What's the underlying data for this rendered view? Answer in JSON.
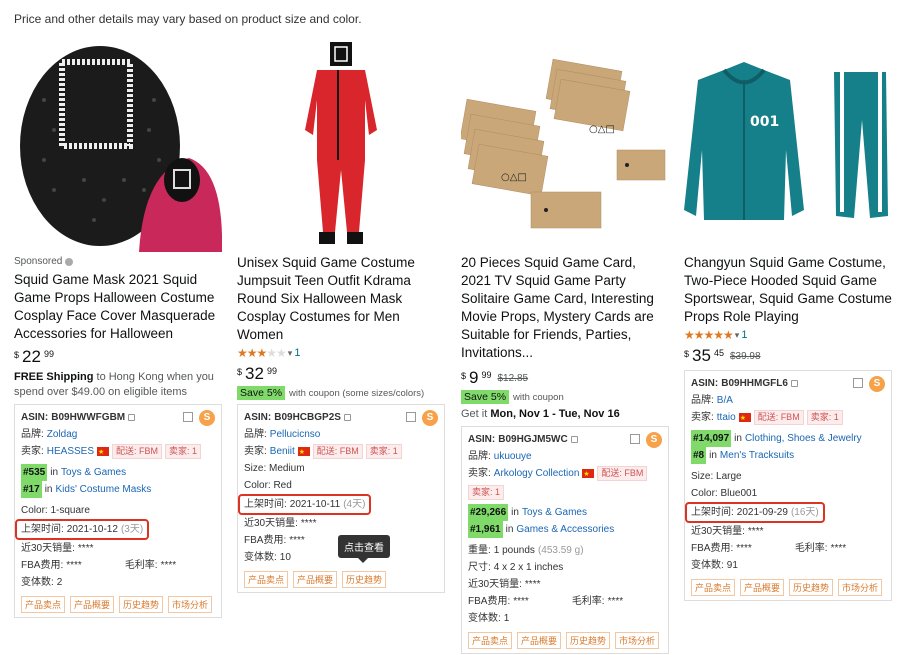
{
  "notice": "Price and other details may vary based on product size and color.",
  "tooltip": "点击查看",
  "products": [
    {
      "sponsored": "Sponsored",
      "title": "Squid Game Mask 2021 Squid Game Props Halloween Costume Cosplay Face Cover Masquerade Accessories for Halloween",
      "price_whole": "22",
      "price_frac": "99",
      "currency": "$",
      "shipping_bold": "FREE Shipping",
      "shipping_rest": " to Hong Kong when you spend over $49.00 on eligible items",
      "asin_label": "ASIN: ",
      "asin": "B09HWWFGBM",
      "brand_label": "品牌:",
      "brand": "Zoldag",
      "seller_label": "卖家:",
      "seller": "HEASSES",
      "tag1": "配送: FBM",
      "tag2": "卖家: 1",
      "rank1": "#535",
      "rank1_in": " in ",
      "rank1_cat": "Toys & Games",
      "rank2": "#17",
      "rank2_in": " in ",
      "rank2_cat": "Kids' Costume Masks",
      "variant": "Color: 1-square",
      "listed_label": "上架时间:",
      "listed_date": "2021-10-12",
      "listed_days": "(3天)",
      "sales_label": "近30天销量:",
      "sales": "****",
      "fba_label": "FBA费用:",
      "fba": "****",
      "margin_label": "毛利率:",
      "margin": "****",
      "variants_label": "变体数:",
      "variants": "2",
      "buttons": [
        "产品卖点",
        "产品概要",
        "历史趋势",
        "市场分析"
      ]
    },
    {
      "title": "Unisex Squid Game Costume Jumpsuit Teen Outfit Kdrama Round Six Halloween Mask Cosplay Costumes for Men Women",
      "rating_count": "1",
      "price_whole": "32",
      "price_frac": "99",
      "currency": "$",
      "coupon_badge": "Save 5%",
      "coupon_text": "with coupon (some sizes/colors)",
      "asin_label": "ASIN: ",
      "asin": "B09HCBGP2S",
      "brand_label": "品牌:",
      "brand": "Pellucicnso",
      "seller_label": "卖家:",
      "seller": "Beniit",
      "tag1": "配送: FBM",
      "tag2": "卖家: 1",
      "size": "Size: Medium",
      "variant": "Color: Red",
      "listed_label": "上架时间:",
      "listed_date": "2021-10-11",
      "listed_days": "(4天)",
      "sales_label": "近30天销量:",
      "sales": "****",
      "fba_label": "FBA费用:",
      "fba": "****",
      "variants_label": "变体数:",
      "variants": "10",
      "buttons": [
        "产品卖点",
        "产品概要",
        "历史趋势"
      ]
    },
    {
      "title": "20 Pieces Squid Game Card, 2021 TV Squid Game Party Solitaire Game Card, Interesting Movie Props, Mystery Cards are Suitable for Friends, Parties, Invitations...",
      "price_whole": "9",
      "price_frac": "99",
      "currency": "$",
      "list_price": "$12.85",
      "coupon_badge": "Save 5%",
      "coupon_text": "with coupon",
      "delivery_pre": "Get it ",
      "delivery_date": "Mon, Nov 1 - Tue, Nov 16",
      "asin_label": "ASIN: ",
      "asin": "B09HGJM5WC",
      "brand_label": "品牌:",
      "brand": "ukuouye",
      "seller_label": "卖家:",
      "seller": "Arkology Collection",
      "tag1": "配送: FBM",
      "tag2": "卖家: 1",
      "rank1": "#29,266",
      "rank1_in": " in ",
      "rank1_cat": "Toys & Games",
      "rank2": "#1,961",
      "rank2_in": " in ",
      "rank2_cat": "Games & Accessories",
      "weight_label": "重量:",
      "weight": "1 pounds",
      "weight_g": "(453.59 g)",
      "dims_label": "尺寸:",
      "dims": "4 x 2 x 1 inches",
      "sales_label": "近30天销量:",
      "sales": "****",
      "fba_label": "FBA费用:",
      "fba": "****",
      "margin_label": "毛利率:",
      "margin": "****",
      "variants_label": "变体数:",
      "variants": "1",
      "buttons": [
        "产品卖点",
        "产品概要",
        "历史趋势",
        "市场分析"
      ]
    },
    {
      "title": "Changyun Squid Game Costume, Two-Piece Hooded Squid Game Sportswear, Squid Game Costume Props Role Playing",
      "rating_count": "1",
      "price_whole": "35",
      "price_frac": "45",
      "currency": "$",
      "list_price": "$39.98",
      "asin_label": "ASIN: ",
      "asin": "B09HHMGFL6",
      "brand_label": "品牌:",
      "brand": "B/A",
      "seller_label": "卖家:",
      "seller": "ttaio",
      "tag1": "配送: FBM",
      "tag2": "卖家: 1",
      "rank1": "#14,097",
      "rank1_in": " in ",
      "rank1_cat": "Clothing, Shoes & Jewelry",
      "rank2": "#8",
      "rank2_in": " in ",
      "rank2_cat": "Men's Tracksuits",
      "size": "Size: Large",
      "variant": "Color: Blue001",
      "listed_label": "上架时间:",
      "listed_date": "2021-09-29",
      "listed_days": "(16天)",
      "sales_label": "近30天销量:",
      "sales": "****",
      "fba_label": "FBA费用:",
      "fba": "****",
      "margin_label": "毛利率:",
      "margin": "****",
      "variants_label": "变体数:",
      "variants": "91",
      "buttons": [
        "产品卖点",
        "产品概要",
        "历史趋势",
        "市场分析"
      ]
    }
  ]
}
